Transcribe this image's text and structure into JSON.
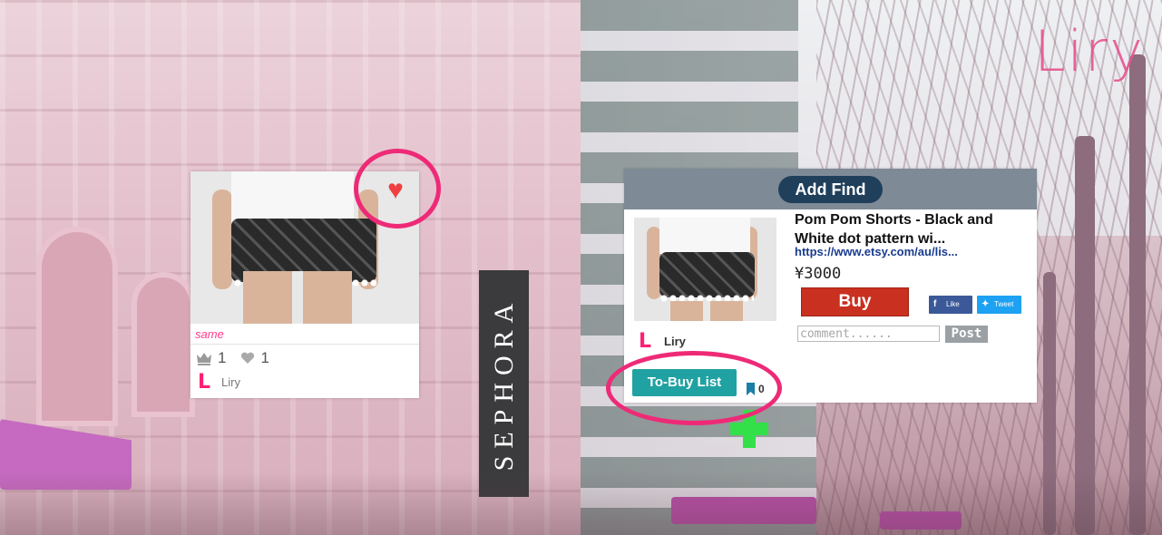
{
  "brand": {
    "logo_text": "Liry"
  },
  "background": {
    "storefront_sign": "SEPHORA"
  },
  "card": {
    "tag": "same",
    "likes_crown": "1",
    "likes_heart": "1",
    "user_name": "Liry",
    "user_mark": "L",
    "heart_glyph": "♥"
  },
  "panel": {
    "header_label": "Add Find",
    "product_title": "Pom Pom Shorts - Black and White dot pattern wi...",
    "product_url": "https://www.etsy.com/au/lis...",
    "price": "¥3000",
    "buy_label": "Buy",
    "fb_label": "Like",
    "tw_label": "Tweet",
    "comment_placeholder": "comment......",
    "post_label": "Post",
    "user_mark": "L",
    "user_name": "Liry",
    "tobuy_label": "To-Buy List",
    "bookmark_count": "0"
  },
  "colors": {
    "accent_pink": "#ee2a77",
    "buy_red": "#c9301f",
    "teal": "#21a2a2",
    "header_navy": "#1f3f5b",
    "facebook": "#3b5998",
    "twitter": "#1da1f2"
  }
}
